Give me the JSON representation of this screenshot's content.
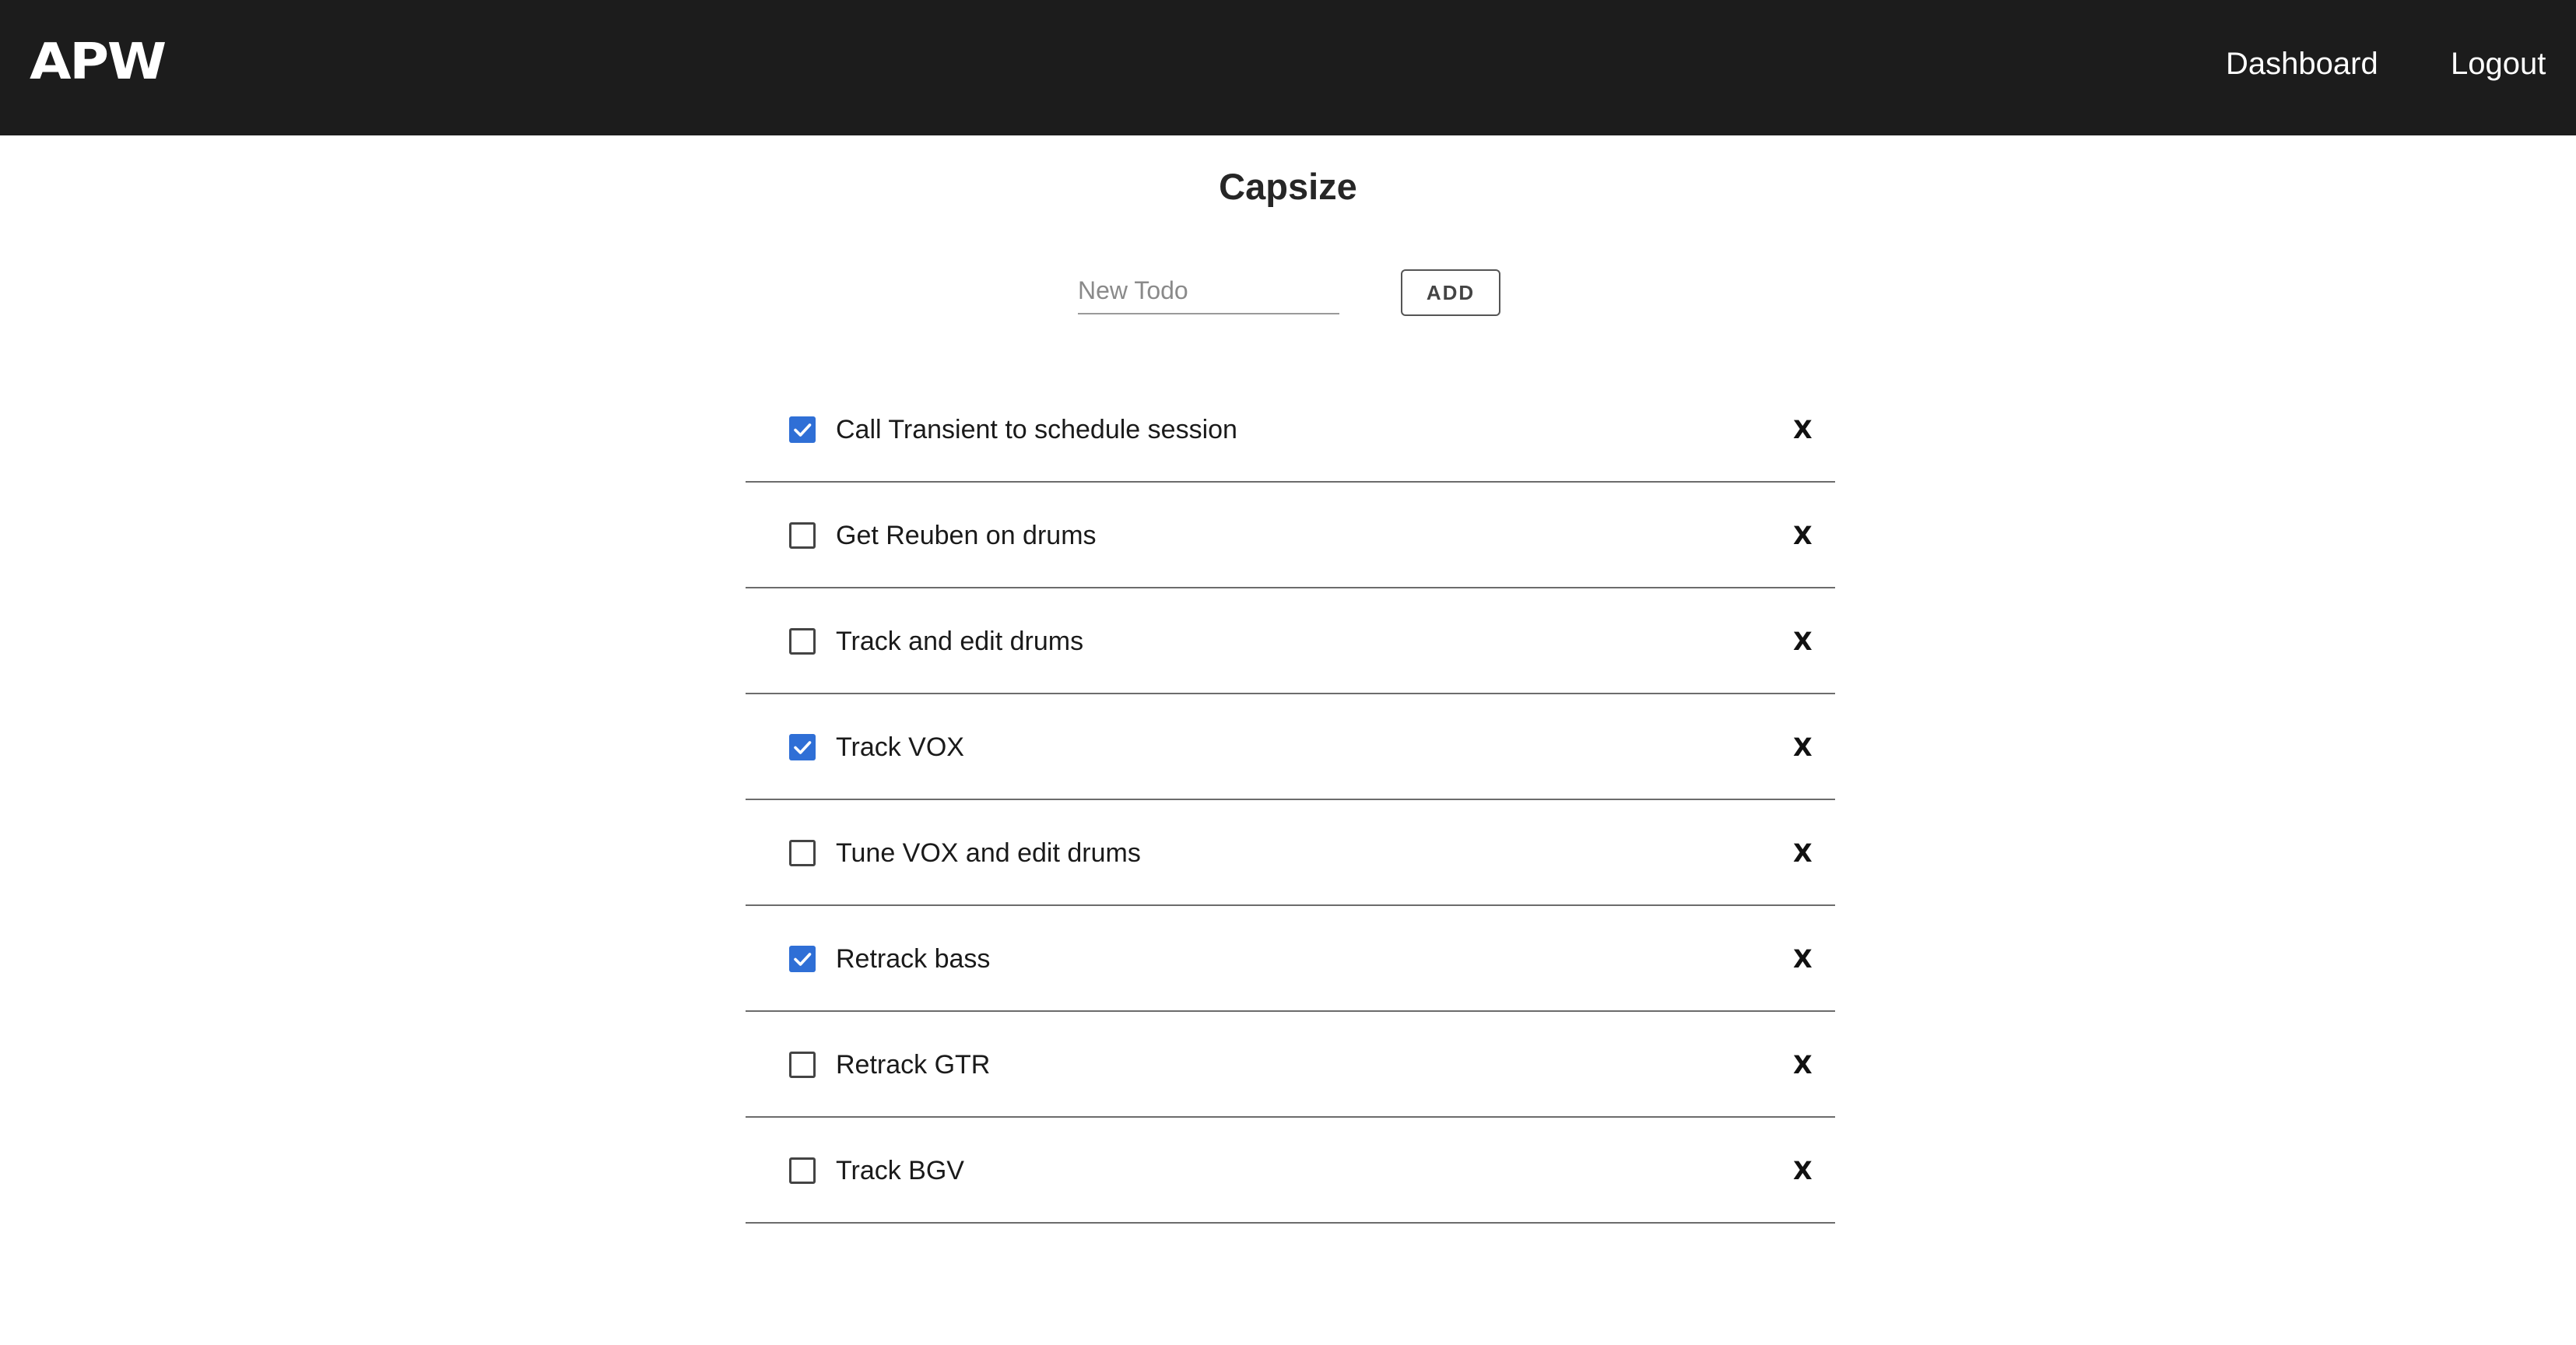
{
  "header": {
    "logo": "APW",
    "nav": {
      "dashboard": "Dashboard",
      "logout": "Logout"
    }
  },
  "page": {
    "title": "Capsize"
  },
  "new_todo": {
    "placeholder": "New Todo",
    "value": "",
    "add_label": "ADD"
  },
  "todos": [
    {
      "text": "Call Transient to schedule session",
      "checked": true,
      "delete_label": "X"
    },
    {
      "text": "Get Reuben on drums",
      "checked": false,
      "delete_label": "X"
    },
    {
      "text": "Track and edit drums",
      "checked": false,
      "delete_label": "X"
    },
    {
      "text": "Track VOX",
      "checked": true,
      "delete_label": "X"
    },
    {
      "text": "Tune VOX and edit drums",
      "checked": false,
      "delete_label": "X"
    },
    {
      "text": "Retrack bass",
      "checked": true,
      "delete_label": "X"
    },
    {
      "text": "Retrack GTR",
      "checked": false,
      "delete_label": "X"
    },
    {
      "text": "Track BGV",
      "checked": false,
      "delete_label": "X"
    }
  ],
  "colors": {
    "header_bg": "#1c1c1c",
    "checkbox_checked": "#2f6fd6"
  },
  "icons": {
    "checkbox_checked": "check-icon"
  }
}
